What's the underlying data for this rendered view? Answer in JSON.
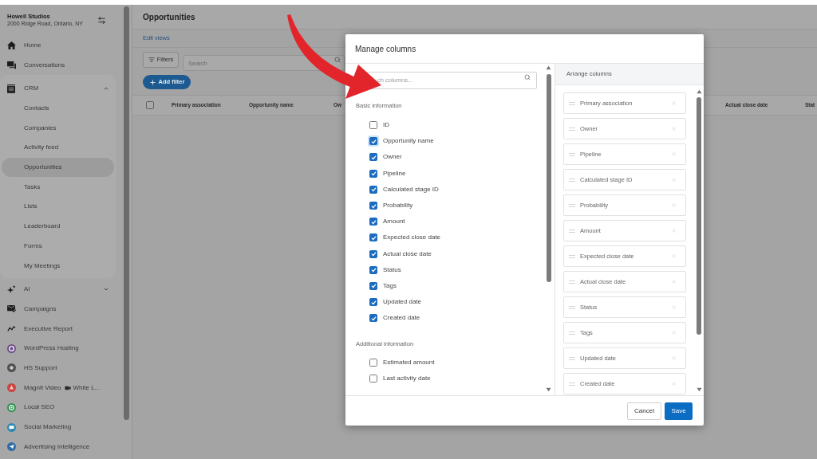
{
  "sidebar": {
    "account": {
      "name": "Howell Studios",
      "address": "2000 Ridge Road, Ontario, NY"
    },
    "items": [
      {
        "kind": "link",
        "label": "Home",
        "selected": false
      },
      {
        "kind": "link",
        "label": "Conversations",
        "selected": false
      },
      {
        "kind": "group",
        "label": "CRM",
        "selected": false,
        "expanded": true,
        "children": [
          {
            "label": "Contacts",
            "selected": false
          },
          {
            "label": "Companies",
            "selected": false
          },
          {
            "label": "Activity feed",
            "selected": false
          },
          {
            "label": "Opportunities",
            "selected": true
          },
          {
            "label": "Tasks",
            "selected": false
          },
          {
            "label": "Lists",
            "selected": false
          },
          {
            "label": "Leaderboard",
            "selected": false
          },
          {
            "label": "Forms",
            "selected": false
          },
          {
            "label": "My Meetings",
            "selected": false
          }
        ]
      },
      {
        "kind": "group",
        "label": "AI",
        "selected": false,
        "expanded": false
      },
      {
        "kind": "link",
        "label": "Campaigns",
        "selected": false
      },
      {
        "kind": "link",
        "label": "Executive Report",
        "selected": false
      },
      {
        "kind": "app",
        "label": "WordPress Hosting",
        "selected": false,
        "color": "#6f4d86"
      },
      {
        "kind": "app",
        "label": "HS Support",
        "selected": false,
        "color": "#505050"
      },
      {
        "kind": "app",
        "label": "Magnfi Video",
        "trailing_label": "White L...",
        "selected": false,
        "color": "#c9433f"
      },
      {
        "kind": "app",
        "label": "Local SEO",
        "selected": false,
        "color": "#2f8f4e"
      },
      {
        "kind": "app",
        "label": "Social Marketing",
        "selected": false,
        "color": "#2f89b3"
      },
      {
        "kind": "app",
        "label": "Advertising Intelligence",
        "selected": false,
        "color": "#2d6ea6"
      }
    ]
  },
  "main": {
    "title": "Opportunities",
    "edit_views": "Edit views",
    "filters_button": "Filters",
    "search": {
      "placeholder": "Search"
    },
    "add_filter_button": "Add filter",
    "table": {
      "select_all_checked": false,
      "columns": [
        "Primary association",
        "Opportunity name",
        "Ow",
        "Actual close date",
        "Stat"
      ]
    }
  },
  "dialog": {
    "title": "Manage columns",
    "search": {
      "placeholder": "ch columns..."
    },
    "sections": [
      {
        "heading": "Basic information",
        "options": [
          {
            "label": "ID",
            "checked": false,
            "focused": false
          },
          {
            "label": "Opportunity name",
            "checked": true,
            "focused": true
          },
          {
            "label": "Owner",
            "checked": true,
            "focused": false
          },
          {
            "label": "Pipeline",
            "checked": true,
            "focused": false
          },
          {
            "label": "Calculated stage ID",
            "checked": true,
            "focused": false
          },
          {
            "label": "Probability",
            "checked": true,
            "focused": false
          },
          {
            "label": "Amount",
            "checked": true,
            "focused": false
          },
          {
            "label": "Expected close date",
            "checked": true,
            "focused": false
          },
          {
            "label": "Actual close date",
            "checked": true,
            "focused": false
          },
          {
            "label": "Status",
            "checked": true,
            "focused": false
          },
          {
            "label": "Tags",
            "checked": true,
            "focused": false
          },
          {
            "label": "Updated date",
            "checked": true,
            "focused": false
          },
          {
            "label": "Created date",
            "checked": true,
            "focused": false
          }
        ]
      },
      {
        "heading": "Additional information",
        "options": [
          {
            "label": "Estimated amount",
            "checked": false,
            "focused": false
          },
          {
            "label": "Last activity date",
            "checked": false,
            "focused": false
          }
        ]
      }
    ],
    "arrange": {
      "heading": "Arrange columns",
      "columns": [
        "Primary association",
        "Owner",
        "Pipeline",
        "Calculated stage ID",
        "Probability",
        "Amount",
        "Expected close date",
        "Actual close date",
        "Status",
        "Tags",
        "Updated date",
        "Created date"
      ]
    },
    "buttons": [
      {
        "kind": "secondary",
        "label": "Cancel"
      },
      {
        "kind": "primary",
        "label": "Save"
      }
    ]
  }
}
